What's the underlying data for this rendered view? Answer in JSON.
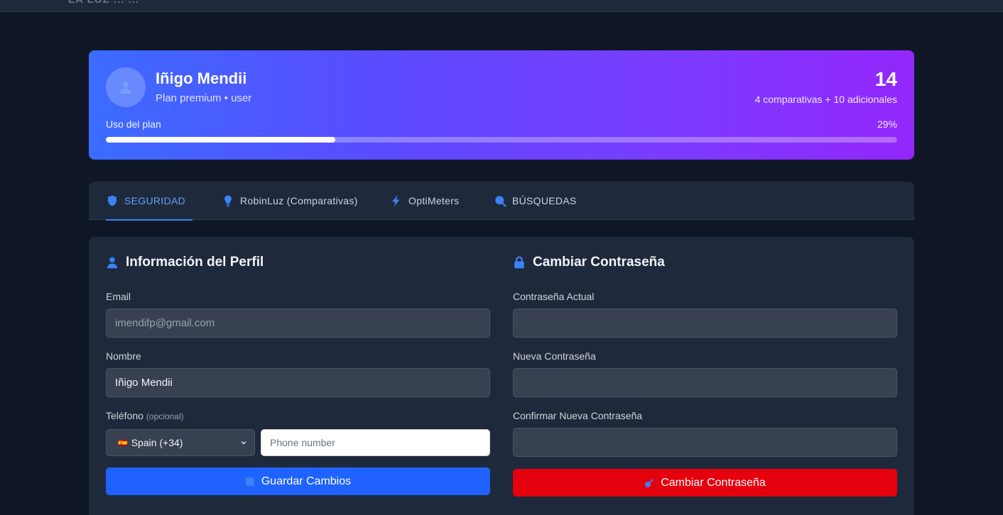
{
  "header": {
    "logo_text": "LA LUZ ... ..."
  },
  "profile": {
    "name": "Iñigo Mendii",
    "plan_line": "Plan premium • user",
    "count": "14",
    "count_detail": "4 comparativas + 10 adicionales",
    "usage_label": "Uso del plan",
    "usage_percent_text": "29%",
    "usage_fraction": 0.29
  },
  "tabs": [
    {
      "label": "SEGURIDAD",
      "icon": "shield-icon",
      "active": true
    },
    {
      "label": "RobinLuz (Comparativas)",
      "icon": "lightbulb-icon",
      "active": false
    },
    {
      "label": "OptiMeters",
      "icon": "bolt-icon",
      "active": false
    },
    {
      "label": "BÚSQUEDAS",
      "icon": "search-icon",
      "active": false
    }
  ],
  "profile_form": {
    "title": "Información del Perfil",
    "email_label": "Email",
    "email_value": "imendifp@gmail.com",
    "name_label": "Nombre",
    "name_value": "Iñigo Mendii",
    "phone_label": "Teléfono",
    "phone_optional": "(opcional)",
    "country_flag": "🇪🇸",
    "country_value": "Spain (+34)",
    "phone_placeholder": "Phone number",
    "save_button": "Guardar Cambios"
  },
  "password_form": {
    "title": "Cambiar Contraseña",
    "current_label": "Contraseña Actual",
    "new_label": "Nueva Contraseña",
    "confirm_label": "Confirmar Nueva Contraseña",
    "submit_button": "Cambiar Contraseña"
  },
  "colors": {
    "accent": "#3b82f6",
    "save_button": "#1f62ff",
    "danger_button": "#e5000e",
    "banner_start": "#3b6cff",
    "banner_end": "#9327fb"
  }
}
